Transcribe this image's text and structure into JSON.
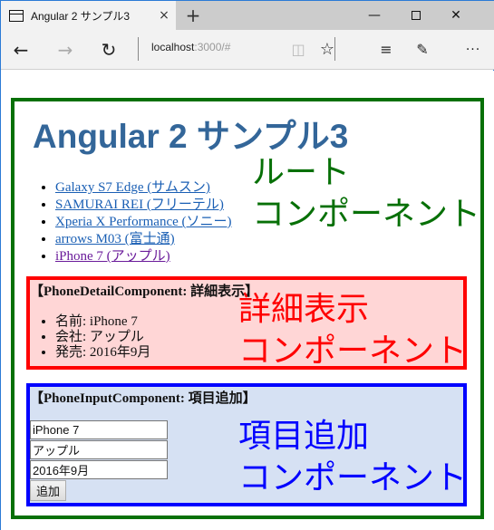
{
  "browser": {
    "tab_title": "Angular 2 サンプル3",
    "tab_close_icon": "×",
    "new_tab_icon": "+",
    "minimize_icon": "—",
    "close_icon": "✕",
    "back_icon": "←",
    "forward_icon": "→",
    "refresh_icon": "↻",
    "address_host": "localhost",
    "address_rest": ":3000/#",
    "reading_view_icon": "📖",
    "favorite_icon": "☆",
    "hub_icon": "≡",
    "web_note_icon": "✎",
    "more_icon": "···"
  },
  "page": {
    "title": "Angular 2 サンプル3",
    "root_label_line1": "ルート",
    "root_label_line2": "コンポーネント",
    "phones": [
      {
        "label": "Galaxy S7 Edge (サムスン)",
        "visited": false
      },
      {
        "label": "SAMURAI REI (フリーテル)",
        "visited": false
      },
      {
        "label": "Xperia X Performance (ソニー)",
        "visited": false
      },
      {
        "label": "arrows M03 (富士通)",
        "visited": false
      },
      {
        "label": "iPhone 7 (アップル)",
        "visited": true
      }
    ],
    "detail": {
      "heading": "【PhoneDetailComponent: 詳細表示】",
      "items": [
        "名前: iPhone 7",
        "会社: アップル",
        "発売: 2016年9月"
      ],
      "label_line1": "詳細表示",
      "label_line2": "コンポーネント"
    },
    "input": {
      "heading": "【PhoneInputComponent: 項目追加】",
      "name_value": "iPhone 7",
      "company_value": "アップル",
      "release_value": "2016年9月",
      "add_button": "追加",
      "label_line1": "項目追加",
      "label_line2": "コンポーネント"
    }
  },
  "colors": {
    "title": "#336699",
    "root_border": "#077007",
    "detail_border": "#ff0000",
    "detail_bg": "#ffd6d6",
    "input_border": "#0000ff",
    "input_bg": "#d6e1f3"
  }
}
